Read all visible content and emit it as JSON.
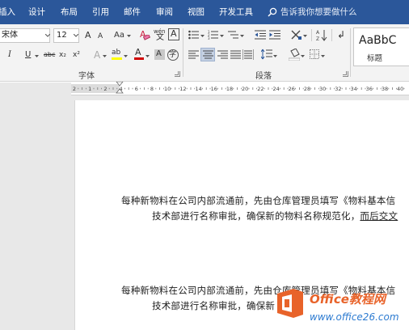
{
  "tabs": [
    "插入",
    "设计",
    "布局",
    "引用",
    "邮件",
    "审阅",
    "视图",
    "开发工具"
  ],
  "tell_me": "告诉我你想要做什么",
  "font": {
    "name": "宋体",
    "size": "12",
    "group_label": "字体",
    "grow_label": "A",
    "shrink_label": "A",
    "case_label": "Aa",
    "clear_label": "A",
    "phonetic_label": "wén",
    "char_border_label": "A",
    "italic": "I",
    "underline": "U",
    "strike": "abc",
    "subscript": "x₂",
    "superscript": "x²",
    "effects_label": "A",
    "highlight_label": "ab",
    "color_label": "A",
    "shading_label": "A",
    "enclose_label": "字",
    "highlight_color": "#ffff00",
    "font_color": "#d00000"
  },
  "paragraph": {
    "group_label": "段落"
  },
  "styles": {
    "sample": "AaBbC",
    "name": "标题"
  },
  "ruler": {
    "labels": [
      "2",
      "1",
      "2",
      "4",
      "6",
      "8",
      "10",
      "12",
      "14",
      "16",
      "18",
      "20",
      "22",
      "24",
      "26",
      "28",
      "30",
      "32",
      "34",
      "36",
      "38",
      "40"
    ]
  },
  "document": {
    "paragraphs": [
      {
        "line1": "每种新物料在公司内部流通前，先由仓库管理员填写《物料基本信",
        "line2_a": "技术部进行名称审批，确保新的物料名称规范化，",
        "line2_b": "而后交文"
      },
      {
        "line1": "每种新物料在公司内部流通前，先由仓库管理员填写《物料基本信",
        "line2_a": "技术部进行名称审批，确保新",
        "line2_b": ""
      }
    ]
  },
  "watermark": {
    "brand": "Office教程网",
    "url": "www.office26.com"
  },
  "colors": {
    "tab_bar": "#2b579a",
    "ribbon": "#f3f3f3",
    "logo_orange": "#e8632a",
    "logo_blue": "#2d7bd1"
  }
}
